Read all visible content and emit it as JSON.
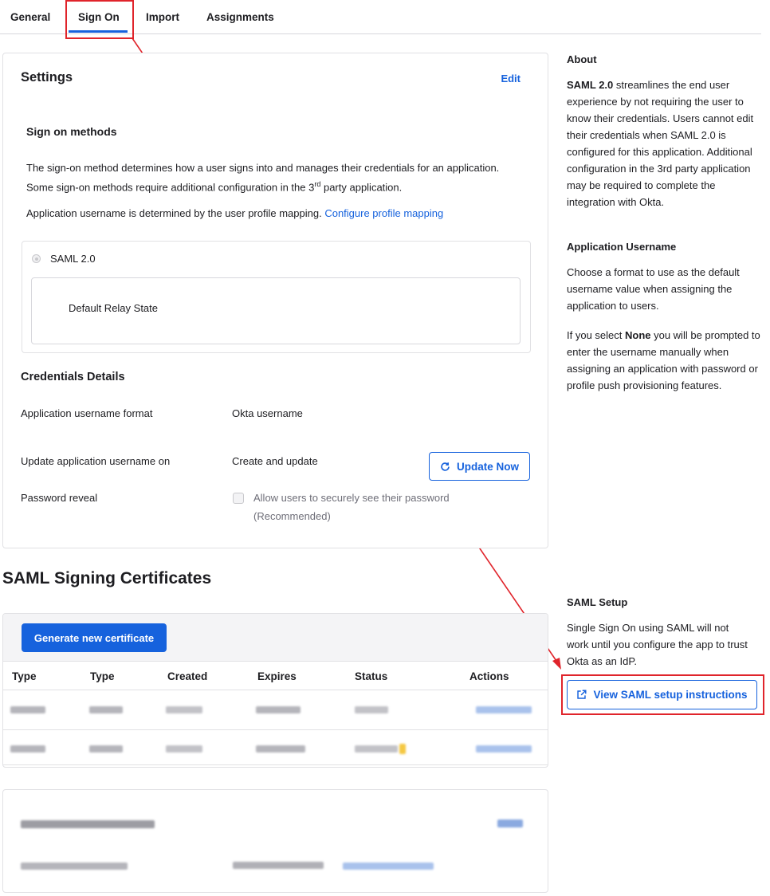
{
  "tabs": [
    {
      "label": "General"
    },
    {
      "label": "Sign On"
    },
    {
      "label": "Import"
    },
    {
      "label": "Assignments"
    }
  ],
  "settings": {
    "title": "Settings",
    "edit_label": "Edit",
    "sign_on_methods_title": "Sign on methods",
    "desc_part1": "The sign-on method determines how a user signs into and manages their credentials for an application. Some sign-on methods require additional configuration in the 3",
    "desc_sup": "rd",
    "desc_part2": " party application.",
    "username_text": "Application username is determined by the user profile mapping.",
    "username_link": "Configure profile mapping",
    "method_label": "SAML 2.0",
    "relay_state_label": "Default Relay State"
  },
  "credentials": {
    "title": "Credentials Details",
    "rows": [
      {
        "label": "Application username format",
        "value": "Okta username"
      },
      {
        "label": "Update application username on",
        "value": "Create and update"
      },
      {
        "label": "Password reveal",
        "value": "Allow users to securely see their password (Recommended)"
      }
    ],
    "update_button": "Update Now"
  },
  "certificates": {
    "title": "SAML Signing Certificates",
    "generate_button": "Generate new certificate",
    "columns": [
      "Type",
      "Type",
      "Created",
      "Expires",
      "Status",
      "Actions"
    ]
  },
  "sidebar": {
    "about_title": "About",
    "about_bold": "SAML 2.0",
    "about_text": " streamlines the end user experience by not requiring the user to know their credentials. Users cannot edit their credentials when SAML 2.0 is configured for this application. Additional configuration in the 3rd party application may be required to complete the integration with Okta.",
    "app_username_title": "Application Username",
    "app_username_text": "Choose a format to use as the default username value when assigning the application to users.",
    "none_prefix": "If you select ",
    "none_bold": "None",
    "none_text": " you will be prompted to enter the username manually when assigning an application with password or profile push provisioning features.",
    "saml_setup_title": "SAML Setup",
    "saml_setup_text": "Single Sign On using SAML will not work until you configure the app to trust Okta as an IdP.",
    "setup_button": "View SAML setup instructions"
  },
  "colors": {
    "accent": "#1662dd",
    "annotation": "#e0242b"
  }
}
